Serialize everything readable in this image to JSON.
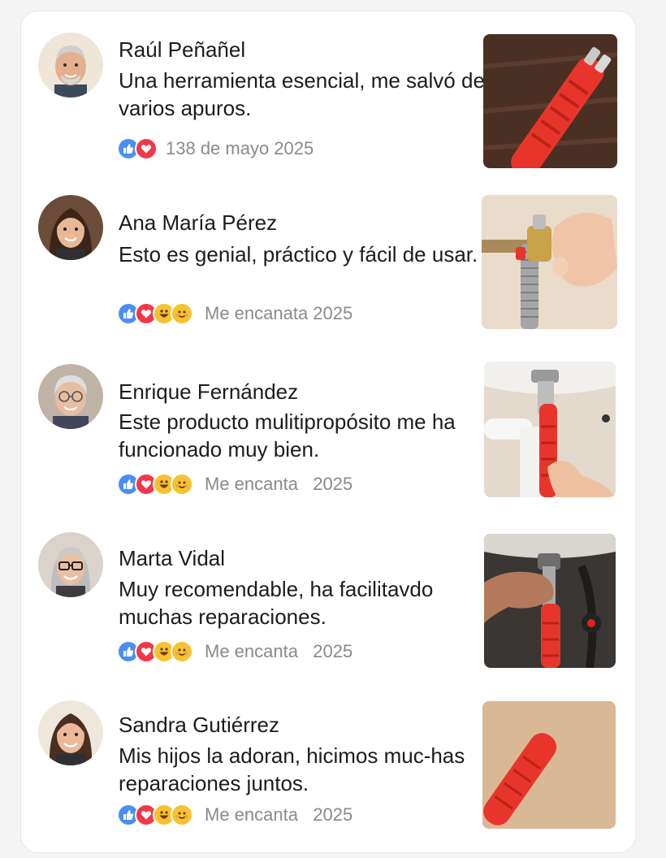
{
  "reviews": [
    {
      "name": "Raúl Peñañel",
      "text": "Una herramienta esencial, me salvó de varios apuros.",
      "meta": "138 de mayo 2025",
      "reactions": [
        "like-icon",
        "love-icon"
      ],
      "avatar_icon": "avatar-older-man",
      "image_icon": "red-wrench-on-wood-photo"
    },
    {
      "name": "Ana María Pérez",
      "text": "Esto es genial, práctico y fácil de usar.",
      "meta": "Me encanata 2025",
      "reactions": [
        "like-icon",
        "love-icon",
        "haha-icon",
        "care-icon"
      ],
      "avatar_icon": "avatar-woman",
      "image_icon": "hand-tightening-valve-photo"
    },
    {
      "name": "Enrique Fernández",
      "text": "Este producto mulitipropósito me ha funcionado muy bien.",
      "meta": "Me encanta   2025",
      "reactions": [
        "like-icon",
        "love-icon",
        "haha-icon",
        "care-icon"
      ],
      "avatar_icon": "avatar-older-man-glasses",
      "image_icon": "wrench-under-sink-photo"
    },
    {
      "name": "Marta Vidal",
      "text": "Muy recomendable, ha facilitavdo muchas reparaciones.",
      "meta": "Me encanta   2025",
      "reactions": [
        "like-icon",
        "love-icon",
        "haha-icon",
        "care-icon"
      ],
      "avatar_icon": "avatar-woman-glasses",
      "image_icon": "hand-using-wrench-photo"
    },
    {
      "name": "Sandra Gutiérrez",
      "text": "Mis hijos la adoran, hicimos muc-has reparaciones juntos.",
      "meta": "Me encanta   2025",
      "reactions": [
        "like-icon",
        "love-icon",
        "haha-icon",
        "care-icon"
      ],
      "avatar_icon": "avatar-woman-smiling",
      "image_icon": "red-wrench-on-beige-photo"
    }
  ],
  "colors": {
    "like": "#4a8ef5",
    "love": "#f0384a",
    "emoji": "#f6c22f",
    "tool_red": "#e8352b",
    "meta_text": "#8a8a8e"
  }
}
